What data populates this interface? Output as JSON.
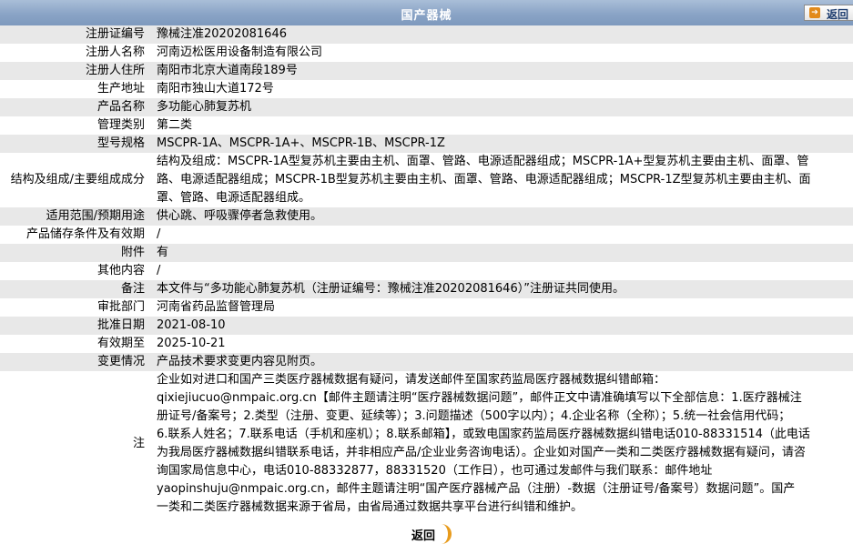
{
  "header": {
    "title": "国产器械",
    "back_label": "返回"
  },
  "rows": [
    {
      "label": "注册证编号",
      "value": "豫械注准20202081646"
    },
    {
      "label": "注册人名称",
      "value": "河南迈松医用设备制造有限公司"
    },
    {
      "label": "注册人住所",
      "value": "南阳市北京大道南段189号"
    },
    {
      "label": "生产地址",
      "value": "南阳市独山大道172号"
    },
    {
      "label": "产品名称",
      "value": "多功能心肺复苏机"
    },
    {
      "label": "管理类别",
      "value": "第二类"
    },
    {
      "label": "型号规格",
      "value": "MSCPR-1A、MSCPR-1A+、MSCPR-1B、MSCPR-1Z"
    },
    {
      "label": "结构及组成/主要组成成分",
      "lines": [
        "结构及组成：MSCPR-1A型复苏机主要由主机、面罩、管路、电源适配器组成；MSCPR-1A+型复苏机主要由主机、面罩、管",
        "路、电源适配器组成；MSCPR-1B型复苏机主要由主机、面罩、管路、电源适配器组成；MSCPR-1Z型复苏机主要由主机、面",
        "罩、管路、电源适配器组成。"
      ]
    },
    {
      "label": "适用范围/预期用途",
      "value": "供心跳、呼吸骤停者急救使用。"
    },
    {
      "label": "产品储存条件及有效期",
      "value": "/"
    },
    {
      "label": "附件",
      "value": "有"
    },
    {
      "label": "其他内容",
      "value": "/"
    },
    {
      "label": "备注",
      "value": "本文件与“多功能心肺复苏机（注册证编号：豫械注准20202081646）”注册证共同使用。"
    },
    {
      "label": "审批部门",
      "value": "河南省药品监督管理局"
    },
    {
      "label": "批准日期",
      "value": "2021-08-10"
    },
    {
      "label": "有效期至",
      "value": "2025-10-21"
    },
    {
      "label": "变更情况",
      "value": "产品技术要求变更内容见附页。"
    },
    {
      "label": "注",
      "lines": [
        "企业如对进口和国产三类医疗器械数据有疑问，请发送邮件至国家药监局医疗器械数据纠错邮箱：",
        "qixiejiucuo@nmpaic.org.cn【邮件主题请注明“医疗器械数据问题”，邮件正文中请准确填写以下全部信息：1.医疗器械注",
        "册证号/备案号；2.类型（注册、变更、延续等）；3.问题描述（500字以内）；4.企业名称（全称）；5.统一社会信用代码；",
        "6.联系人姓名；7.联系电话（手机和座机）；8.联系邮箱】，或致电国家药监局医疗器械数据纠错电话010-88331514（此电话",
        "为我局医疗器械数据纠错联系电话，并非相应产品/企业业务咨询电话）。企业如对国产一类和二类医疗器械数据有疑问，请咨",
        "询国家局信息中心，电话010-88332877，88331520（工作日），也可通过发邮件与我们联系：邮件地址",
        "yaopinshuju@nmpaic.org.cn，邮件主题请注明“国产医疗器械产品（注册）-数据（注册证号/备案号）数据问题”。国产",
        "一类和二类医疗器械数据来源于省局，由省局通过数据共享平台进行纠错和维护。"
      ]
    }
  ],
  "footer": {
    "back_label": "返回"
  }
}
